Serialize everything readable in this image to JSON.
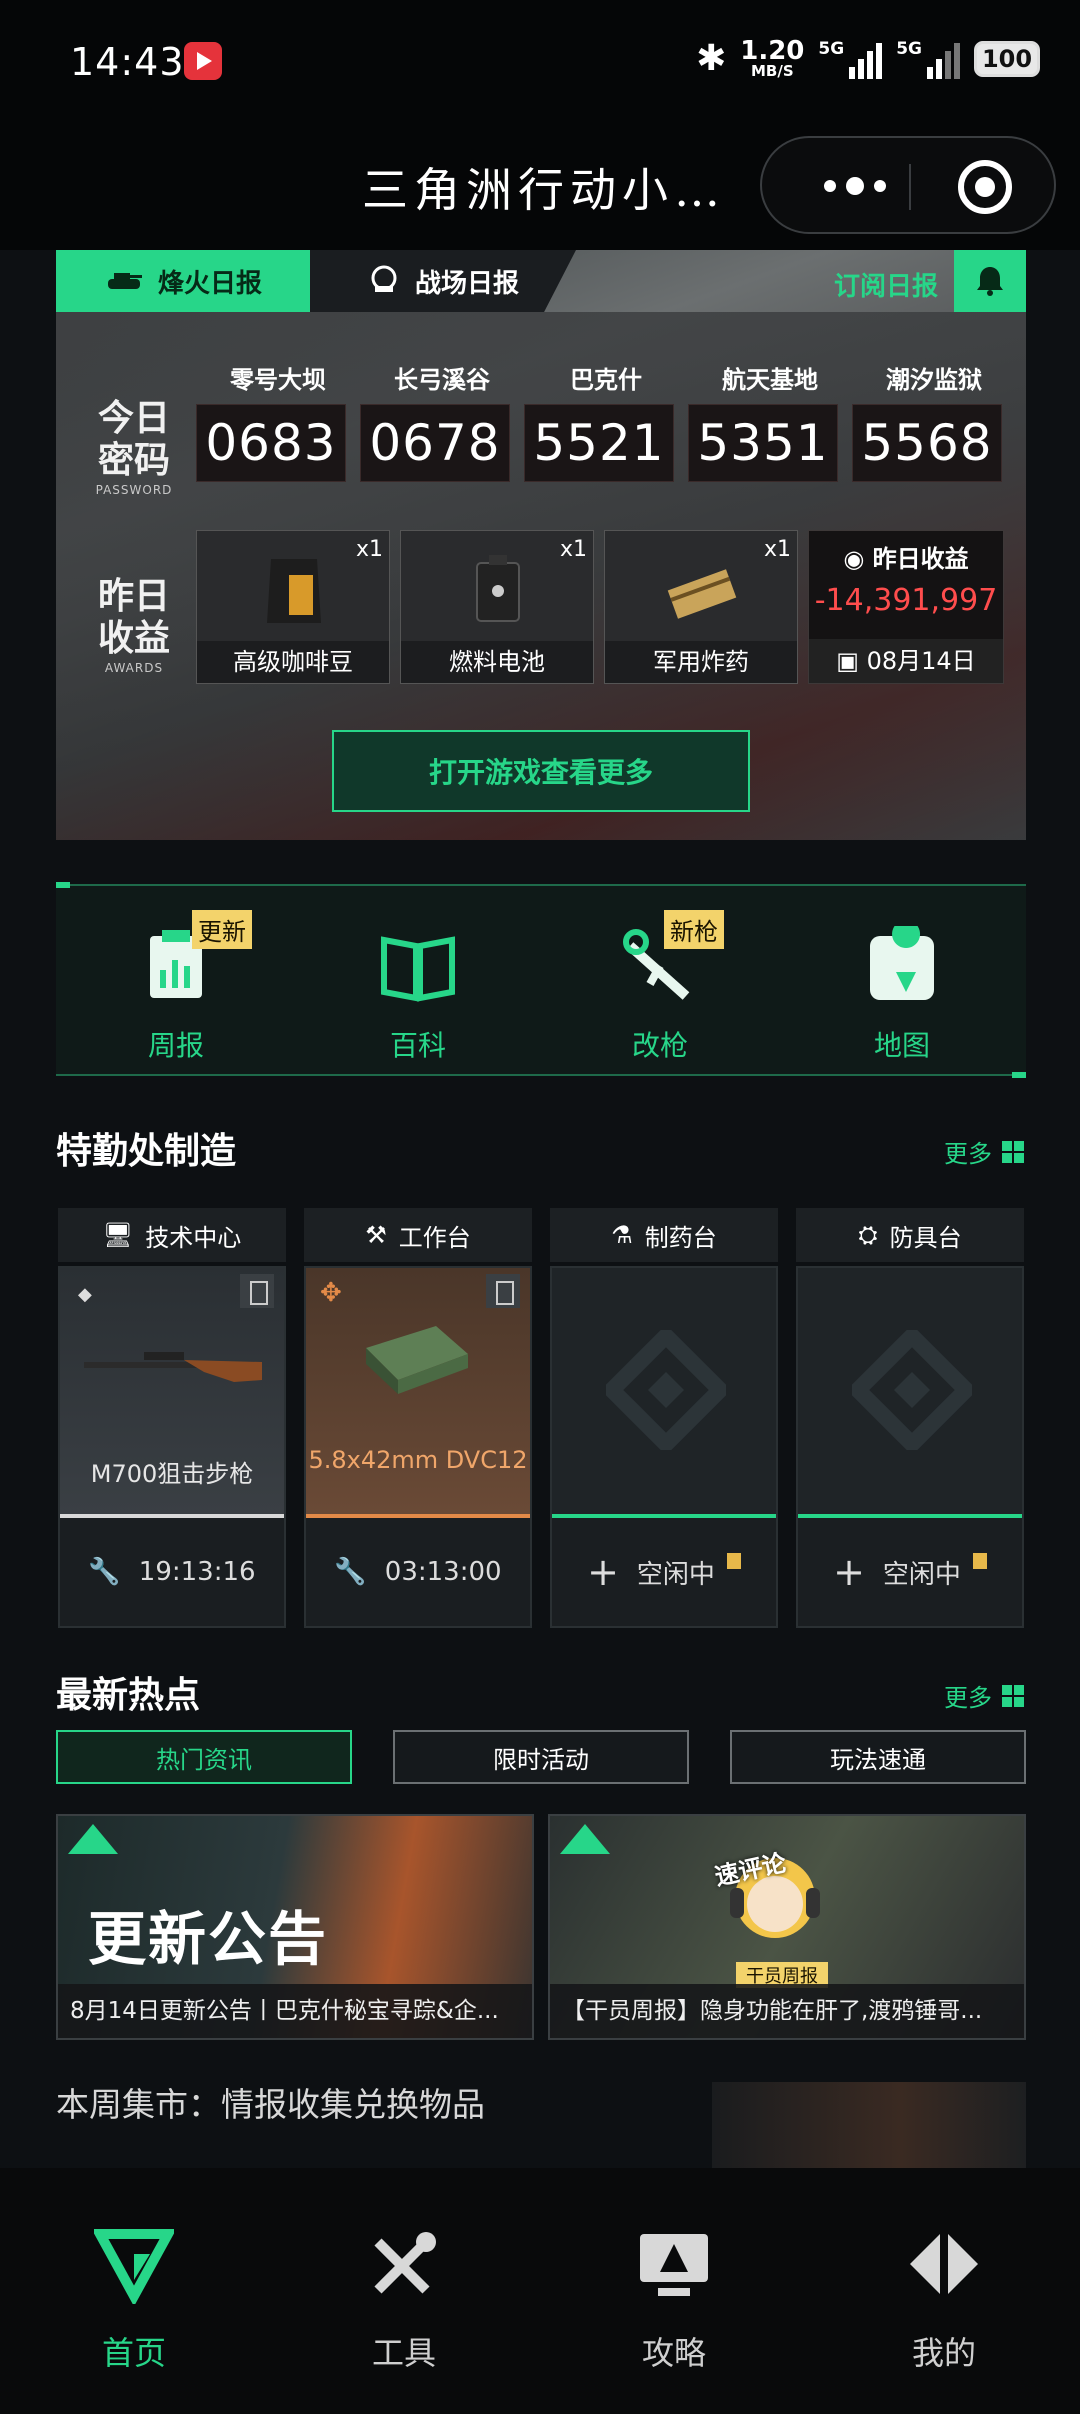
{
  "status_bar": {
    "time": "14:43",
    "net_speed": "1.20",
    "net_unit": "MB/S",
    "sim1": "5G",
    "sim2": "5G",
    "battery": "100"
  },
  "title_bar": {
    "title": "三角洲行动小…"
  },
  "report": {
    "tabs": [
      "烽火日报",
      "战场日报"
    ],
    "subscribe": "订阅日报",
    "password_label": "今日",
    "password_label2": "密码",
    "password_sub": "PASSWORD",
    "maps": [
      {
        "name": "零号大坝",
        "code": "0683"
      },
      {
        "name": "长弓溪谷",
        "code": "0678"
      },
      {
        "name": "巴克什",
        "code": "5521"
      },
      {
        "name": "航天基地",
        "code": "5351"
      },
      {
        "name": "潮汐监狱",
        "code": "5568"
      }
    ],
    "rewards_label": "昨日",
    "rewards_label2": "收益",
    "rewards_sub": "AWARDS",
    "items": [
      {
        "name": "高级咖啡豆",
        "qty": "x1"
      },
      {
        "name": "燃料电池",
        "qty": "x1"
      },
      {
        "name": "军用炸药",
        "qty": "x1"
      }
    ],
    "income_title": "昨日收益",
    "income_value": "-14,391,997",
    "income_date": "08月14日",
    "open_game": "打开游戏查看更多"
  },
  "quick_nav": [
    {
      "label": "周报",
      "badge": "更新"
    },
    {
      "label": "百科",
      "badge": ""
    },
    {
      "label": "改枪",
      "badge": "新枪"
    },
    {
      "label": "地图",
      "badge": ""
    }
  ],
  "workshop": {
    "title": "特勤处制造",
    "more": "更多",
    "stations": [
      {
        "name": "技术中心",
        "item": "M700狙击步枪",
        "status": "19:13:16"
      },
      {
        "name": "工作台",
        "item": "5.8x42mm DVC12",
        "status": "03:13:00"
      },
      {
        "name": "制药台",
        "item": "",
        "status": "空闲中"
      },
      {
        "name": "防具台",
        "item": "",
        "status": "空闲中"
      }
    ]
  },
  "news": {
    "title": "最新热点",
    "more": "更多",
    "tabs": [
      "热门资讯",
      "限时活动",
      "玩法速通"
    ],
    "cards": [
      {
        "banner": "更新公告",
        "caption": "8月14日更新公告丨巴克什秘宝寻踪&企..."
      },
      {
        "banner": "速评论",
        "tag": "干员周报",
        "caption": "【干员周报】隐身功能在肝了,渡鸦锤哥..."
      }
    ],
    "weekly": "本周集市：情报收集兑换物品"
  },
  "bottom_nav": [
    {
      "label": "首页",
      "active": true
    },
    {
      "label": "工具",
      "active": false
    },
    {
      "label": "攻略",
      "active": false
    },
    {
      "label": "我的",
      "active": false
    }
  ],
  "colors": {
    "accent": "#27d689",
    "loss": "#ff4d4d",
    "badge": "#f3d36b"
  }
}
